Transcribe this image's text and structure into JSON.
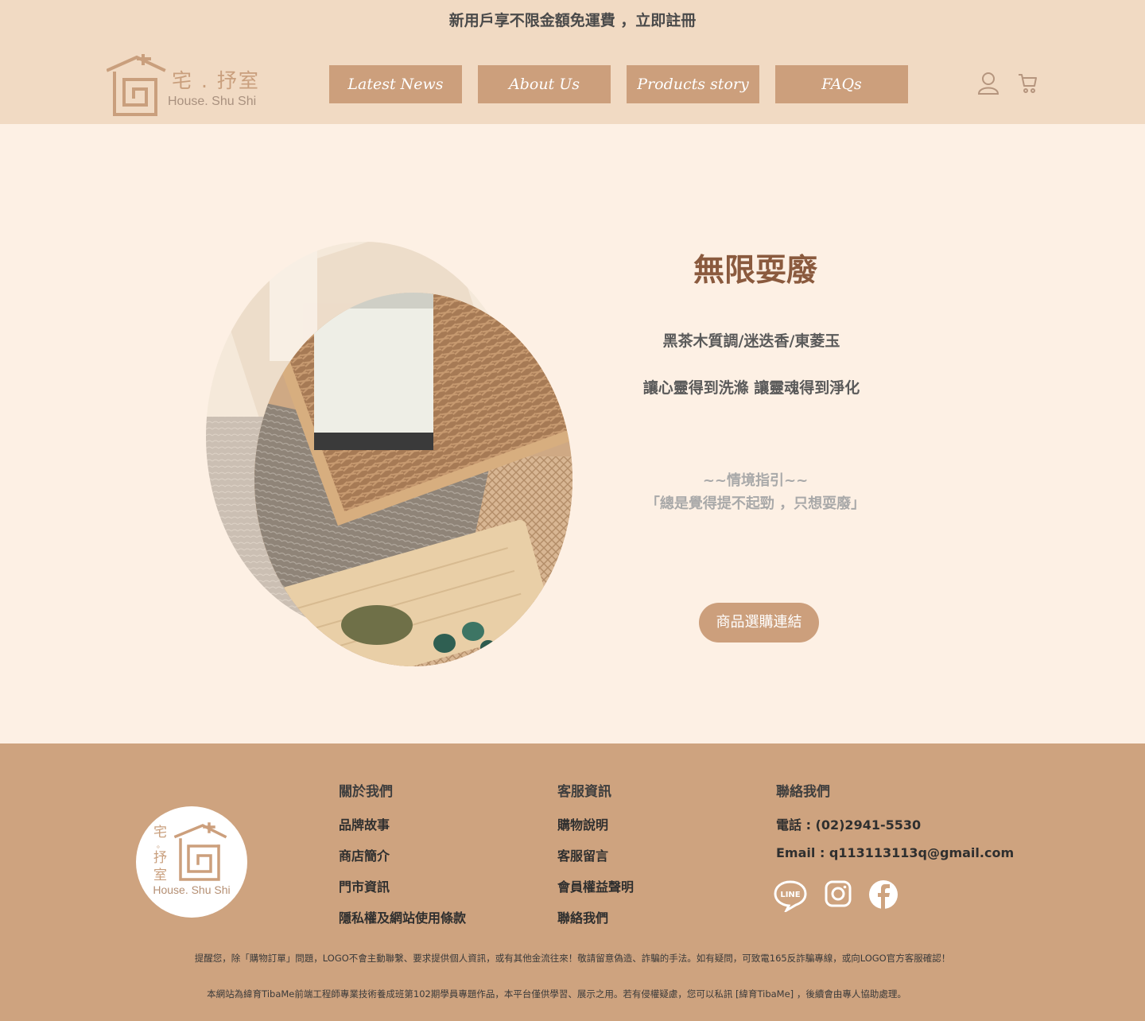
{
  "promo": {
    "text": "新用戶享不限金額免運費 ，立即註冊"
  },
  "brand": {
    "name_zh": "宅 . 抒室",
    "name_en": "House. Shu Shi"
  },
  "nav": [
    {
      "label": "Latest News"
    },
    {
      "label": "About Us"
    },
    {
      "label": "Products story"
    },
    {
      "label": "FAQs"
    }
  ],
  "product": {
    "title": "無限耍廢",
    "notes": "黑茶木質調/迷迭香/東菱玉",
    "tagline": "讓心靈得到洗滌 讓靈魂得到淨化",
    "scene_title": "~~情境指引~~",
    "scene_text": "「總是覺得提不起勁 ，只想耍廢」",
    "buy_label": "商品選購連結"
  },
  "footer": {
    "logo_zh": "宅。抒室",
    "logo_en": "House. Shu Shi",
    "about": {
      "heading": "關於我們",
      "links": [
        "品牌故事",
        "商店簡介",
        "門市資訊",
        "隱私權及網站使用條款"
      ]
    },
    "service": {
      "heading": "客服資訊",
      "links": [
        "購物說明",
        "客服留言",
        "會員權益聲明",
        "聯絡我們"
      ]
    },
    "contact": {
      "heading": "聯絡我們",
      "phone": "電話 : (02)2941-5530",
      "email": "Email : q113113113q@gmail.com"
    },
    "social": [
      "line-icon",
      "instagram-icon",
      "facebook-icon"
    ],
    "notice1": "提醒您，除「購物訂單」問題，LOGO不會主動聯繫、要求提供個人資訊，或有其他金流往來！敬請留意偽造、詐騙的手法。如有疑問，可致電165反詐騙專線，或向LOGO官方客服確認！",
    "notice2": "本網站為緯育TibaMe前端工程師專業技術養成班第102期學員專題作品，本平台僅供學習、展示之用。若有侵權疑慮，您可以私訊 [緯育TibaMe] ，後續會由專人協助處理。"
  },
  "colors": {
    "header_bg": "#f1dac3",
    "page_bg": "#fdf0e4",
    "accent": "#cc9f7c",
    "footer_bg": "#cea37f",
    "title": "#8a5a3e"
  }
}
